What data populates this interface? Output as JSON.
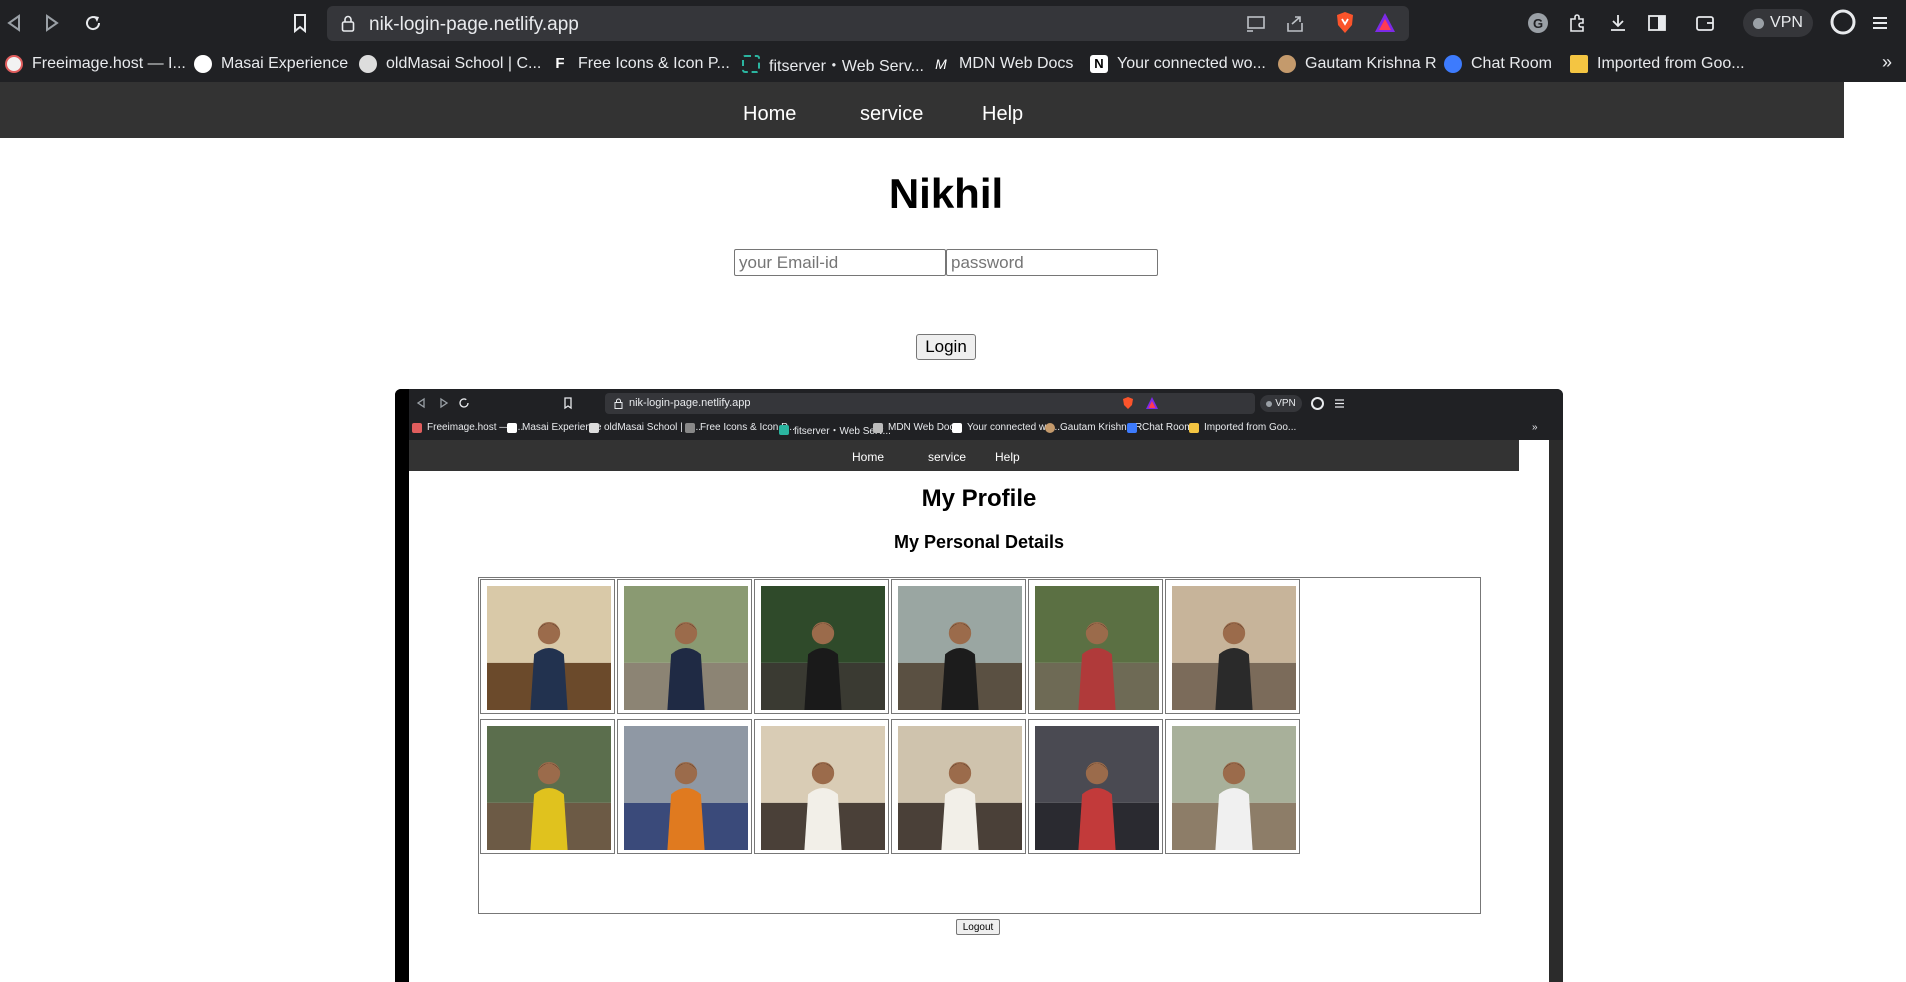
{
  "browser": {
    "url": "nik-login-page.netlify.app",
    "vpn_label": "VPN",
    "more_label": "»",
    "bookmarks": [
      {
        "label": "Freeimage.host — I...",
        "color": "#e05d5d"
      },
      {
        "label": "Masai Experience",
        "color": "#ffffff"
      },
      {
        "label": "oldMasai School | C...",
        "color": "#dddddd"
      },
      {
        "label": "Free Icons & Icon P...",
        "color": "#ffffff"
      },
      {
        "label": "fitserver・Web Serv...",
        "color": "#2bb5a0"
      },
      {
        "label": "MDN Web Docs",
        "color": "#ffffff"
      },
      {
        "label": "Your connected wo...",
        "color": "#ffffff"
      },
      {
        "label": "Gautam Krishna R",
        "color": "#c49a6c"
      },
      {
        "label": "Chat Room",
        "color": "#3d7bfd"
      },
      {
        "label": "Imported from Goo...",
        "color": "#f4c542"
      }
    ]
  },
  "page": {
    "nav": [
      "Home",
      "service",
      "Help"
    ],
    "title": "Nikhil",
    "email_placeholder": "your Email-id",
    "password_placeholder": "password",
    "login_label": "Login"
  },
  "embedded": {
    "url": "nik-login-page.netlify.app",
    "vpn_label": "VPN",
    "more_label": "»",
    "bookmarks": [
      "Freeimage.host — I...",
      "Masai Experience",
      "oldMasai School | C...",
      "Free Icons & Icon P...",
      "fitserver・Web Serv...",
      "MDN Web Docs",
      "Your connected wo...",
      "Gautam Krishna R",
      "Chat Room",
      "Imported from Goo..."
    ],
    "nav": [
      "Home",
      "service",
      "Help"
    ],
    "title": "My Profile",
    "subtitle": "My Personal Details",
    "logout_label": "Logout",
    "photos": [
      {
        "name": "photo-dinner-table",
        "sky": "#d9c9a8",
        "ground": "#6b4a2b",
        "figure": "#22324f"
      },
      {
        "name": "photo-with-horse",
        "sky": "#8a9a72",
        "ground": "#8c8474",
        "figure": "#1f2a44"
      },
      {
        "name": "photo-waterfall-rock",
        "sky": "#2f4a2a",
        "ground": "#3a3a32",
        "figure": "#1a1a1a"
      },
      {
        "name": "photo-waterfall-side",
        "sky": "#9aa6a2",
        "ground": "#5a5042",
        "figure": "#1c1c1c"
      },
      {
        "name": "photo-mossy-rocks",
        "sky": "#5b7043",
        "ground": "#6e6a55",
        "figure": "#b03a3a"
      },
      {
        "name": "photo-bear-statue",
        "sky": "#c7b49a",
        "ground": "#7b6b5a",
        "figure": "#2a2a2a"
      },
      {
        "name": "photo-yellow-sweater-bench",
        "sky": "#5b6e4d",
        "ground": "#6c5a45",
        "figure": "#e0c21e"
      },
      {
        "name": "photo-orange-scarf",
        "sky": "#8f98a4",
        "ground": "#3a4a7a",
        "figure": "#e07a1f"
      },
      {
        "name": "photo-white-kurta-1",
        "sky": "#d9ccb5",
        "ground": "#4a4038",
        "figure": "#f2efe8"
      },
      {
        "name": "photo-white-kurta-2",
        "sky": "#cfc3ad",
        "ground": "#4a4038",
        "figure": "#f2efe8"
      },
      {
        "name": "photo-group-shop",
        "sky": "#4a4a52",
        "ground": "#2a2a30",
        "figure": "#c23a3a"
      },
      {
        "name": "photo-horse-street",
        "sky": "#a8b09a",
        "ground": "#8d7d68",
        "figure": "#f0f0f0"
      }
    ]
  }
}
